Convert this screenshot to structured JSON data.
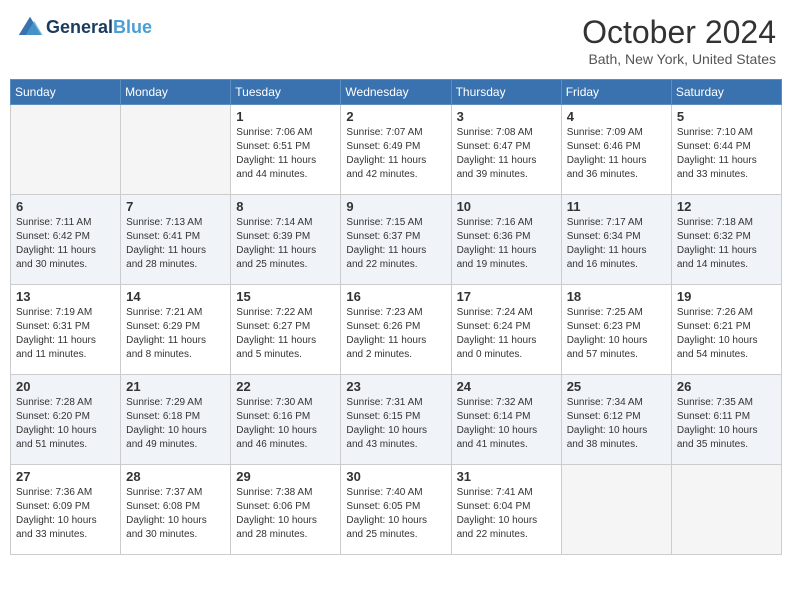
{
  "header": {
    "logo_line1": "General",
    "logo_line2": "Blue",
    "month": "October 2024",
    "location": "Bath, New York, United States"
  },
  "days_of_week": [
    "Sunday",
    "Monday",
    "Tuesday",
    "Wednesday",
    "Thursday",
    "Friday",
    "Saturday"
  ],
  "weeks": [
    [
      {
        "day": "",
        "info": ""
      },
      {
        "day": "",
        "info": ""
      },
      {
        "day": "1",
        "info": "Sunrise: 7:06 AM\nSunset: 6:51 PM\nDaylight: 11 hours and 44 minutes."
      },
      {
        "day": "2",
        "info": "Sunrise: 7:07 AM\nSunset: 6:49 PM\nDaylight: 11 hours and 42 minutes."
      },
      {
        "day": "3",
        "info": "Sunrise: 7:08 AM\nSunset: 6:47 PM\nDaylight: 11 hours and 39 minutes."
      },
      {
        "day": "4",
        "info": "Sunrise: 7:09 AM\nSunset: 6:46 PM\nDaylight: 11 hours and 36 minutes."
      },
      {
        "day": "5",
        "info": "Sunrise: 7:10 AM\nSunset: 6:44 PM\nDaylight: 11 hours and 33 minutes."
      }
    ],
    [
      {
        "day": "6",
        "info": "Sunrise: 7:11 AM\nSunset: 6:42 PM\nDaylight: 11 hours and 30 minutes."
      },
      {
        "day": "7",
        "info": "Sunrise: 7:13 AM\nSunset: 6:41 PM\nDaylight: 11 hours and 28 minutes."
      },
      {
        "day": "8",
        "info": "Sunrise: 7:14 AM\nSunset: 6:39 PM\nDaylight: 11 hours and 25 minutes."
      },
      {
        "day": "9",
        "info": "Sunrise: 7:15 AM\nSunset: 6:37 PM\nDaylight: 11 hours and 22 minutes."
      },
      {
        "day": "10",
        "info": "Sunrise: 7:16 AM\nSunset: 6:36 PM\nDaylight: 11 hours and 19 minutes."
      },
      {
        "day": "11",
        "info": "Sunrise: 7:17 AM\nSunset: 6:34 PM\nDaylight: 11 hours and 16 minutes."
      },
      {
        "day": "12",
        "info": "Sunrise: 7:18 AM\nSunset: 6:32 PM\nDaylight: 11 hours and 14 minutes."
      }
    ],
    [
      {
        "day": "13",
        "info": "Sunrise: 7:19 AM\nSunset: 6:31 PM\nDaylight: 11 hours and 11 minutes."
      },
      {
        "day": "14",
        "info": "Sunrise: 7:21 AM\nSunset: 6:29 PM\nDaylight: 11 hours and 8 minutes."
      },
      {
        "day": "15",
        "info": "Sunrise: 7:22 AM\nSunset: 6:27 PM\nDaylight: 11 hours and 5 minutes."
      },
      {
        "day": "16",
        "info": "Sunrise: 7:23 AM\nSunset: 6:26 PM\nDaylight: 11 hours and 2 minutes."
      },
      {
        "day": "17",
        "info": "Sunrise: 7:24 AM\nSunset: 6:24 PM\nDaylight: 11 hours and 0 minutes."
      },
      {
        "day": "18",
        "info": "Sunrise: 7:25 AM\nSunset: 6:23 PM\nDaylight: 10 hours and 57 minutes."
      },
      {
        "day": "19",
        "info": "Sunrise: 7:26 AM\nSunset: 6:21 PM\nDaylight: 10 hours and 54 minutes."
      }
    ],
    [
      {
        "day": "20",
        "info": "Sunrise: 7:28 AM\nSunset: 6:20 PM\nDaylight: 10 hours and 51 minutes."
      },
      {
        "day": "21",
        "info": "Sunrise: 7:29 AM\nSunset: 6:18 PM\nDaylight: 10 hours and 49 minutes."
      },
      {
        "day": "22",
        "info": "Sunrise: 7:30 AM\nSunset: 6:16 PM\nDaylight: 10 hours and 46 minutes."
      },
      {
        "day": "23",
        "info": "Sunrise: 7:31 AM\nSunset: 6:15 PM\nDaylight: 10 hours and 43 minutes."
      },
      {
        "day": "24",
        "info": "Sunrise: 7:32 AM\nSunset: 6:14 PM\nDaylight: 10 hours and 41 minutes."
      },
      {
        "day": "25",
        "info": "Sunrise: 7:34 AM\nSunset: 6:12 PM\nDaylight: 10 hours and 38 minutes."
      },
      {
        "day": "26",
        "info": "Sunrise: 7:35 AM\nSunset: 6:11 PM\nDaylight: 10 hours and 35 minutes."
      }
    ],
    [
      {
        "day": "27",
        "info": "Sunrise: 7:36 AM\nSunset: 6:09 PM\nDaylight: 10 hours and 33 minutes."
      },
      {
        "day": "28",
        "info": "Sunrise: 7:37 AM\nSunset: 6:08 PM\nDaylight: 10 hours and 30 minutes."
      },
      {
        "day": "29",
        "info": "Sunrise: 7:38 AM\nSunset: 6:06 PM\nDaylight: 10 hours and 28 minutes."
      },
      {
        "day": "30",
        "info": "Sunrise: 7:40 AM\nSunset: 6:05 PM\nDaylight: 10 hours and 25 minutes."
      },
      {
        "day": "31",
        "info": "Sunrise: 7:41 AM\nSunset: 6:04 PM\nDaylight: 10 hours and 22 minutes."
      },
      {
        "day": "",
        "info": ""
      },
      {
        "day": "",
        "info": ""
      }
    ]
  ]
}
